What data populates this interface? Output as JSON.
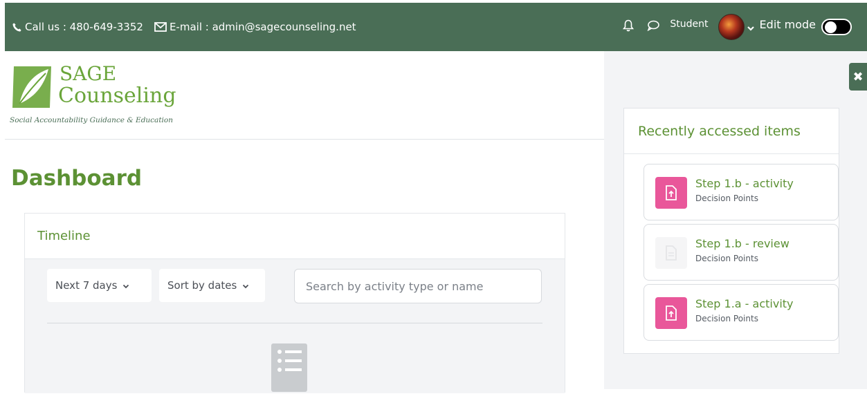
{
  "header": {
    "phone_label": "Call us : 480-649-3352",
    "email_label": "E-mail : admin@sagecounseling.net",
    "username": "Student",
    "edit_mode_label": "Edit mode"
  },
  "logo": {
    "line1": "SAGE",
    "line2": "Counseling",
    "tagline": "Social Accountability Guidance & Education"
  },
  "page": {
    "title": "Dashboard"
  },
  "timeline": {
    "title": "Timeline",
    "day_filter": "Next 7 days",
    "sort_filter": "Sort by dates",
    "search_placeholder": "Search by activity type or name"
  },
  "recently_accessed": {
    "title": "Recently accessed items",
    "items": [
      {
        "title": "Step 1.b - activity",
        "course": "Decision Points",
        "icon": "assignment-icon"
      },
      {
        "title": "Step 1.b - review",
        "course": "Decision Points",
        "icon": "page-icon"
      },
      {
        "title": "Step 1.a - activity",
        "course": "Decision Points",
        "icon": "assignment-icon"
      }
    ]
  },
  "colors": {
    "header_bg": "#4a6e56",
    "accent_green": "#5c9134",
    "activity_pink": "#e9579a"
  }
}
